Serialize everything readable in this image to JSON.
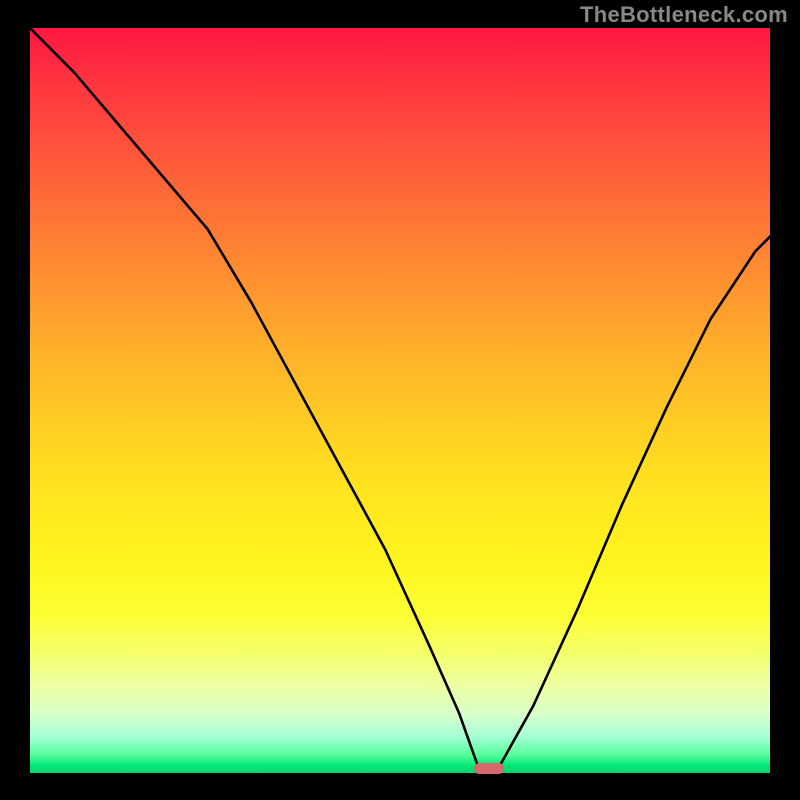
{
  "watermark": "TheBottleneck.com",
  "chart_data": {
    "type": "line",
    "title": "",
    "xlabel": "",
    "ylabel": "",
    "xlim": [
      0,
      100
    ],
    "ylim": [
      0,
      100
    ],
    "series": [
      {
        "name": "curve",
        "x": [
          0,
          6,
          12,
          18,
          24,
          30,
          36,
          42,
          48,
          54,
          58,
          60.5,
          63.5,
          68,
          74,
          80,
          86,
          92,
          98,
          100
        ],
        "y": [
          100,
          94,
          87,
          80,
          73,
          63,
          52,
          41,
          30,
          17,
          8,
          1,
          1,
          9,
          22,
          36,
          49,
          61,
          70,
          72
        ]
      }
    ],
    "marker": {
      "x": 62,
      "y": 0.6,
      "w": 4.0,
      "h": 1.6
    },
    "gradient_stops": [
      {
        "p": 0,
        "c": "#ff173f"
      },
      {
        "p": 50,
        "c": "#ffd322"
      },
      {
        "p": 85,
        "c": "#fcff35"
      },
      {
        "p": 100,
        "c": "#00d46a"
      }
    ]
  }
}
